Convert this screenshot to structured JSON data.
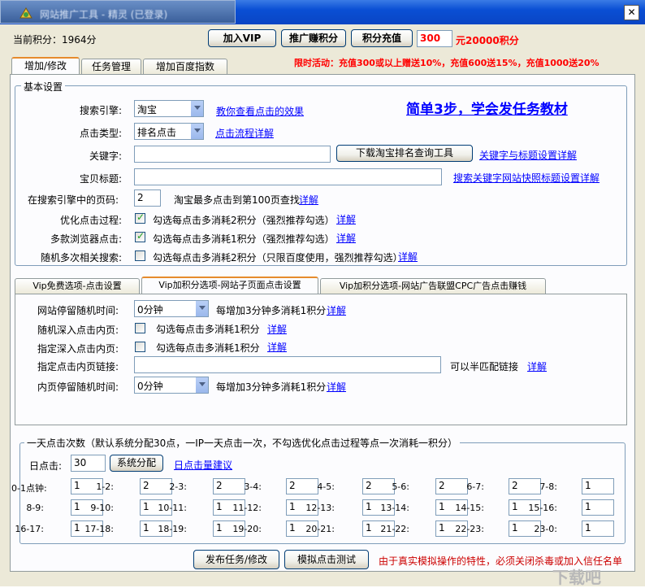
{
  "window": {
    "title": "网站推广工具 - 精灵 (已登录)"
  },
  "header": {
    "points_label": "当前积分：1964分",
    "join_vip": "加入VIP",
    "promote_points": "推广赚积分",
    "recharge_points": "积分充值",
    "recharge_amount": "300",
    "recharge_result": "元20000积分",
    "promo": "限时活动：充值300或以上赠送10%，充值600送15%，充值1000送20%"
  },
  "main_tabs": [
    "增加/修改",
    "任务管理",
    "增加百度指数"
  ],
  "basic": {
    "group_title": "基本设置",
    "tutorial_link": "简单3步，学会发任务教材",
    "engine_label": "搜索引擎:",
    "engine_value": "淘宝",
    "engine_link": "教你查看点击的效果",
    "click_type_label": "点击类型:",
    "click_type_value": "排名点击",
    "click_type_link": "点击流程详解",
    "keyword_label": "关键字:",
    "keyword_value": "",
    "download_tool": "下载淘宝排名查询工具",
    "keyword_link": "关键字与标题设置详解",
    "item_title_label": "宝贝标题:",
    "item_title_value": "",
    "item_title_link": "搜索关键字网站快照标题设置详解",
    "page_label": "在搜索引擎中的页码:",
    "page_value": "2",
    "page_hint": "淘宝最多点击到第100页查找",
    "page_link": "详解",
    "optimize_label": "优化点击过程:",
    "optimize_text": "勾选每点击多消耗2积分（强烈推荐勾选）",
    "optimize_link": "详解",
    "multi_browser_label": "多款浏览器点击:",
    "multi_browser_text": "勾选每点击多消耗1积分（强烈推荐勾选）",
    "multi_browser_link": "详解",
    "random_search_label": "随机多次相关搜索:",
    "random_search_text": "勾选每点击多消耗2积分（只限百度使用，强烈推荐勾选）",
    "random_search_link": "详解"
  },
  "vip_tabs": [
    "Vip免费选项-点击设置",
    "Vip加积分选项-网站子页面点击设置",
    "Vip加积分选项-网站广告联盟CPC广告点击赚钱"
  ],
  "vip": {
    "stay_label": "网站停留随机时间:",
    "stay_value": "0分钟",
    "stay_hint": "每增加3分钟多消耗1积分",
    "stay_link": "详解",
    "random_deep_label": "随机深入点击内页:",
    "random_deep_text": "勾选每点击多消耗1积分",
    "random_deep_link": "详解",
    "fixed_deep_label": "指定深入点击内页:",
    "fixed_deep_text": "勾选每点击多消耗1积分",
    "fixed_deep_link": "详解",
    "fixed_link_label": "指定点击内页链接:",
    "fixed_link_value": "",
    "fixed_link_hint": "可以半匹配链接",
    "fixed_link_link": "详解",
    "inner_stay_label": "内页停留随机时间:",
    "inner_stay_value": "0分钟",
    "inner_stay_hint": "每增加3分钟多消耗1积分",
    "inner_stay_link": "详解"
  },
  "daily": {
    "group_title": "一天点击次数（默认系统分配30点，一IP一天点击一次，不勾选优化点击过程等点一次消耗一积分）",
    "daily_label": "日点击:",
    "daily_value": "30",
    "auto_assign": "系统分配",
    "advice_link": "日点击量建议",
    "hours": [
      {
        "label": "0-1点钟:",
        "value": "1"
      },
      {
        "label": "1-2:",
        "value": "2"
      },
      {
        "label": "2-3:",
        "value": "2"
      },
      {
        "label": "3-4:",
        "value": "2"
      },
      {
        "label": "4-5:",
        "value": "2"
      },
      {
        "label": "5-6:",
        "value": "2"
      },
      {
        "label": "6-7:",
        "value": "2"
      },
      {
        "label": "7-8:",
        "value": "1"
      },
      {
        "label": "8-9:",
        "value": "1"
      },
      {
        "label": "9-10:",
        "value": "1"
      },
      {
        "label": "10-11:",
        "value": "1"
      },
      {
        "label": "11-12:",
        "value": "1"
      },
      {
        "label": "12-13:",
        "value": "1"
      },
      {
        "label": "13-14:",
        "value": "1"
      },
      {
        "label": "14-15:",
        "value": "1"
      },
      {
        "label": "15-16:",
        "value": "1"
      },
      {
        "label": "16-17:",
        "value": "1"
      },
      {
        "label": "17-18:",
        "value": "1"
      },
      {
        "label": "18-19:",
        "value": "1"
      },
      {
        "label": "19-20:",
        "value": "1"
      },
      {
        "label": "20-21:",
        "value": "1"
      },
      {
        "label": "21-22:",
        "value": "1"
      },
      {
        "label": "22-23:",
        "value": "1"
      },
      {
        "label": "23-0:",
        "value": "1"
      }
    ]
  },
  "footer": {
    "publish": "发布任务/修改",
    "simulate": "模拟点击测试",
    "notice": "由于真实模拟操作的特性，必须关闭杀毒或加入信任名单"
  },
  "watermark": "下载吧"
}
